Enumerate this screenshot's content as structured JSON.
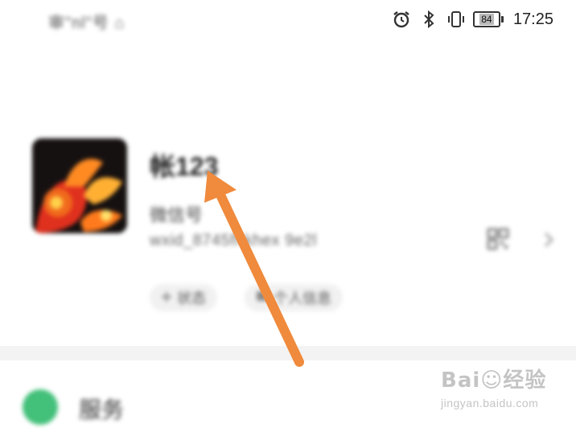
{
  "status_bar": {
    "carrier": "审\"nl\"号 ⌂",
    "battery_level": "84",
    "time": "17:25",
    "icons": [
      "alarm-icon",
      "bluetooth-icon",
      "vibrate-icon",
      "battery-icon"
    ]
  },
  "profile": {
    "name": "帐123",
    "account_label": "微信号",
    "account_id": "wxid_8745fhkhex 9e2l",
    "chips": [
      {
        "icon": "plus-icon",
        "label": "状态"
      },
      {
        "icon": "tag-icon",
        "label": "个人信息"
      }
    ]
  },
  "list": {
    "items": [
      {
        "icon": "service-icon",
        "label": "服务",
        "color": "#43c07a"
      }
    ]
  },
  "watermark": {
    "logo": "Bai☺经验",
    "url": "jingyan.baidu.com"
  },
  "colors": {
    "arrow": "#f08a3c",
    "background": "#ffffff"
  }
}
